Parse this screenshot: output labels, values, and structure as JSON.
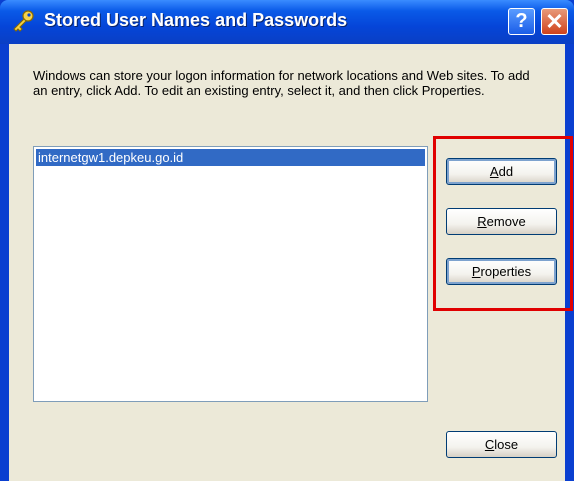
{
  "window": {
    "title": "Stored User Names and Passwords",
    "help_glyph": "?",
    "close_glyph": "✕"
  },
  "description": "Windows can store your logon information for network locations and Web sites. To add an entry, click Add. To edit an existing entry, select it, and then click Properties.",
  "credentials": {
    "items": [
      {
        "label": "internetgw1.depkeu.go.id",
        "selected": true
      }
    ]
  },
  "buttons": {
    "add": {
      "mnemonic": "A",
      "rest": "dd"
    },
    "remove": {
      "mnemonic": "R",
      "rest": "emove"
    },
    "properties": {
      "mnemonic": "P",
      "rest": "roperties"
    },
    "close": {
      "mnemonic": "C",
      "rest": "lose"
    }
  },
  "colors": {
    "titlebar": "#0a5ae8",
    "selection": "#316ac5",
    "highlight_box": "#e00000",
    "dialog_face": "#ece9d8"
  },
  "icons": {
    "title": "key-icon"
  }
}
